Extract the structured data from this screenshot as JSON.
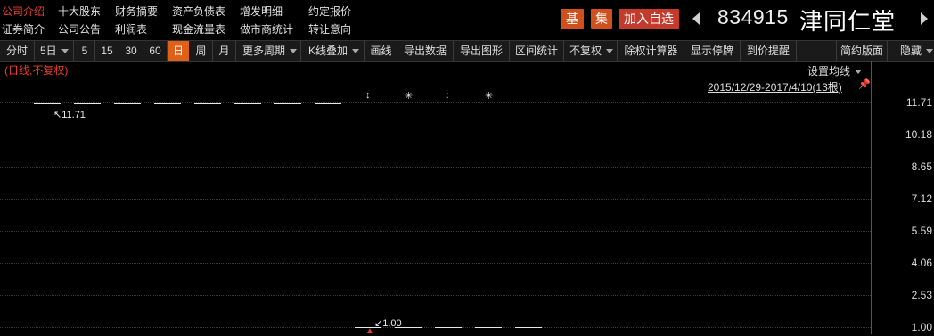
{
  "top_links": {
    "row1": [
      "公司介绍",
      "十大股东",
      "财务摘要",
      "资产负债表",
      "增发明细",
      "约定报价"
    ],
    "row2": [
      "证券简介",
      "公司公告",
      "利润表",
      "现金流量表",
      "做市商统计",
      "转让意向"
    ]
  },
  "header": {
    "btn_ji": "基",
    "btn_jj": "集",
    "btn_add": "加入自选",
    "stock_code": "834915",
    "stock_name": "津同仁堂"
  },
  "toolbar": {
    "items": [
      "分时",
      "5日",
      "5",
      "15",
      "30",
      "60",
      "日",
      "周",
      "月",
      "更多周期",
      "K线叠加",
      "画线",
      "导出数据",
      "导出图形",
      "区间统计",
      "不复权",
      "除权计算器",
      "显示停牌",
      "到价提醒",
      "简约版面",
      "隐藏"
    ],
    "selected": "日"
  },
  "chart_info": {
    "sublabel": "(日线,不复权)",
    "set_avg": "设置均线",
    "date_range": "2015/12/29-2017/4/10(13根)",
    "max_annotation": "11.71",
    "min_annotation": "1.00",
    "pin_icon": "pin-icon"
  },
  "chart_data": {
    "type": "candlestick",
    "y_axis_ticks": [
      "11.71",
      "10.18",
      "8.65",
      "7.12",
      "5.59",
      "4.06",
      "2.53",
      "1.00"
    ],
    "ylim": [
      1.0,
      11.71
    ],
    "date_range": "2015/12/29-2017/4/10",
    "bars": 13,
    "high": 11.71,
    "low": 1.0,
    "up_color": "#e8402f",
    "flat_color": "#e8e8e8"
  }
}
